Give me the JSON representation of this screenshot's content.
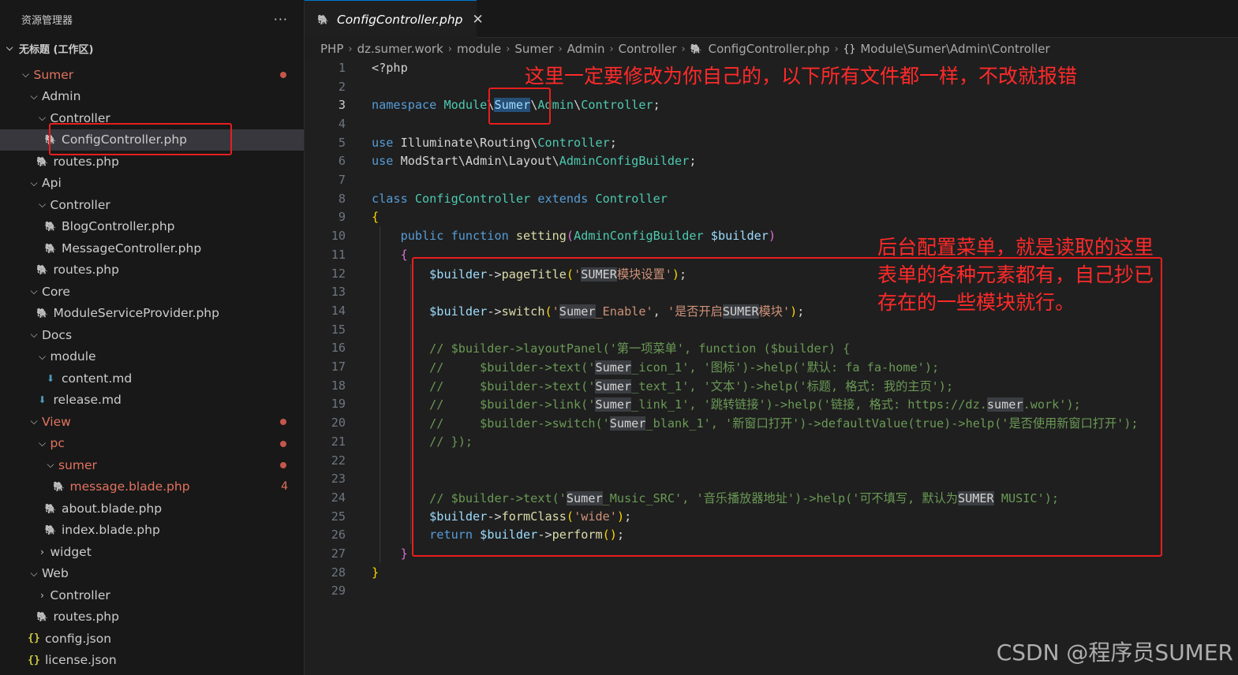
{
  "explorer": {
    "title": "资源管理器",
    "more": "···",
    "workspace": "无标题 (工作区)",
    "items": [
      {
        "label": "Sumer",
        "depth": 1,
        "type": "folder",
        "open": true,
        "modified": true,
        "dot": true
      },
      {
        "label": "Admin",
        "depth": 2,
        "type": "folder",
        "open": true
      },
      {
        "label": "Controller",
        "depth": 3,
        "type": "folder",
        "open": true
      },
      {
        "label": "ConfigController.php",
        "depth": 4,
        "type": "php",
        "selected": true
      },
      {
        "label": "routes.php",
        "depth": 3,
        "type": "php"
      },
      {
        "label": "Api",
        "depth": 2,
        "type": "folder",
        "open": true
      },
      {
        "label": "Controller",
        "depth": 3,
        "type": "folder",
        "open": true
      },
      {
        "label": "BlogController.php",
        "depth": 4,
        "type": "php"
      },
      {
        "label": "MessageController.php",
        "depth": 4,
        "type": "php"
      },
      {
        "label": "routes.php",
        "depth": 3,
        "type": "php"
      },
      {
        "label": "Core",
        "depth": 2,
        "type": "folder",
        "open": true
      },
      {
        "label": "ModuleServiceProvider.php",
        "depth": 3,
        "type": "php"
      },
      {
        "label": "Docs",
        "depth": 2,
        "type": "folder",
        "open": true
      },
      {
        "label": "module",
        "depth": 3,
        "type": "folder",
        "open": true
      },
      {
        "label": "content.md",
        "depth": 4,
        "type": "md"
      },
      {
        "label": "release.md",
        "depth": 3,
        "type": "md"
      },
      {
        "label": "View",
        "depth": 2,
        "type": "folder",
        "open": true,
        "modified": true,
        "dot": true
      },
      {
        "label": "pc",
        "depth": 3,
        "type": "folder",
        "open": true,
        "modified": true,
        "dot": true
      },
      {
        "label": "sumer",
        "depth": 4,
        "type": "folder",
        "open": true,
        "modified": true,
        "dot": true
      },
      {
        "label": "message.blade.php",
        "depth": 5,
        "type": "php",
        "modified": true,
        "badge": "4"
      },
      {
        "label": "about.blade.php",
        "depth": 4,
        "type": "php"
      },
      {
        "label": "index.blade.php",
        "depth": 4,
        "type": "php"
      },
      {
        "label": "widget",
        "depth": 3,
        "type": "folder",
        "open": false
      },
      {
        "label": "Web",
        "depth": 2,
        "type": "folder",
        "open": true
      },
      {
        "label": "Controller",
        "depth": 3,
        "type": "folder",
        "open": false
      },
      {
        "label": "routes.php",
        "depth": 3,
        "type": "php"
      },
      {
        "label": "config.json",
        "depth": 2,
        "type": "json"
      },
      {
        "label": "license.json",
        "depth": 2,
        "type": "json"
      }
    ]
  },
  "tab": {
    "label": "ConfigController.php",
    "close": "✕"
  },
  "breadcrumb": {
    "items": [
      "PHP",
      "dz.sumer.work",
      "module",
      "Sumer",
      "Admin",
      "Controller",
      "ConfigController.php"
    ],
    "symbol_icon": "{}",
    "symbol": "Module\\Sumer\\Admin\\Controller"
  },
  "editor": {
    "current_line": 3,
    "lines": [
      [
        [
          "p",
          "<?php"
        ]
      ],
      [],
      [
        [
          "k",
          "namespace "
        ],
        [
          "t",
          "Module"
        ],
        [
          "p",
          "\\"
        ],
        [
          "hl",
          "Sumer"
        ],
        [
          "p",
          "\\"
        ],
        [
          "t",
          "Admin"
        ],
        [
          "p",
          "\\"
        ],
        [
          "t",
          "Controller"
        ],
        [
          "p",
          ";"
        ]
      ],
      [],
      [
        [
          "k",
          "use "
        ],
        [
          "p",
          "Illuminate\\Routing\\"
        ],
        [
          "t",
          "Controller"
        ],
        [
          "p",
          ";"
        ]
      ],
      [
        [
          "k",
          "use "
        ],
        [
          "p",
          "ModStart\\Admin\\Layout\\"
        ],
        [
          "t",
          "AdminConfigBuilder"
        ],
        [
          "p",
          ";"
        ]
      ],
      [],
      [
        [
          "k",
          "class "
        ],
        [
          "t",
          "ConfigController "
        ],
        [
          "k",
          "extends "
        ],
        [
          "t",
          "Controller"
        ]
      ],
      [
        [
          "b1",
          "{"
        ]
      ],
      [
        [
          "p",
          "    "
        ],
        [
          "k",
          "public function "
        ],
        [
          "f",
          "setting"
        ],
        [
          "b2",
          "("
        ],
        [
          "t",
          "AdminConfigBuilder "
        ],
        [
          "v",
          "$builder"
        ],
        [
          "b2",
          ")"
        ]
      ],
      [
        [
          "p",
          "    "
        ],
        [
          "b2",
          "{"
        ]
      ],
      [
        [
          "p",
          "        "
        ],
        [
          "v",
          "$builder"
        ],
        [
          "p",
          "->"
        ],
        [
          "f",
          "pageTitle"
        ],
        [
          "b1",
          "("
        ],
        [
          "s",
          "'"
        ],
        [
          "hs",
          "SUMER"
        ],
        [
          "s",
          "模块设置'"
        ],
        [
          "b1",
          ")"
        ],
        [
          "p",
          ";"
        ]
      ],
      [],
      [
        [
          "p",
          "        "
        ],
        [
          "v",
          "$builder"
        ],
        [
          "p",
          "->"
        ],
        [
          "f",
          "switch"
        ],
        [
          "b1",
          "("
        ],
        [
          "s",
          "'"
        ],
        [
          "hs",
          "Sumer"
        ],
        [
          "s",
          "_Enable'"
        ],
        [
          "p",
          ", "
        ],
        [
          "s",
          "'是否开启"
        ],
        [
          "hs",
          "SUMER"
        ],
        [
          "s",
          "模块'"
        ],
        [
          "b1",
          ")"
        ],
        [
          "p",
          ";"
        ]
      ],
      [],
      [
        [
          "p",
          "        "
        ],
        [
          "c",
          "// $builder->layoutPanel('第一项菜单', function ($builder) {"
        ]
      ],
      [
        [
          "p",
          "        "
        ],
        [
          "c",
          "//     $builder->text('"
        ],
        [
          "hs",
          "Sumer"
        ],
        [
          "c",
          "_icon_1', '图标')->help('默认: fa fa-home');"
        ]
      ],
      [
        [
          "p",
          "        "
        ],
        [
          "c",
          "//     $builder->text('"
        ],
        [
          "hs",
          "Sumer"
        ],
        [
          "c",
          "_text_1', '文本')->help('标题, 格式: 我的主页');"
        ]
      ],
      [
        [
          "p",
          "        "
        ],
        [
          "c",
          "//     $builder->link('"
        ],
        [
          "hs",
          "Sumer"
        ],
        [
          "c",
          "_link_1', '跳转链接')->help('链接, 格式: https://dz."
        ],
        [
          "hs",
          "sumer"
        ],
        [
          "c",
          ".work');"
        ]
      ],
      [
        [
          "p",
          "        "
        ],
        [
          "c",
          "//     $builder->switch('"
        ],
        [
          "hs",
          "Sumer"
        ],
        [
          "c",
          "_blank_1', '新窗口打开')->defaultValue(true)->help('是否使用新窗口打开');"
        ]
      ],
      [
        [
          "p",
          "        "
        ],
        [
          "c",
          "// });"
        ]
      ],
      [],
      [],
      [
        [
          "p",
          "        "
        ],
        [
          "c",
          "// $builder->text('"
        ],
        [
          "hs",
          "Sumer"
        ],
        [
          "c",
          "_Music_SRC', '音乐播放器地址')->help('可不填写, 默认为"
        ],
        [
          "hs",
          "SUMER"
        ],
        [
          "c",
          " MUSIC');"
        ]
      ],
      [
        [
          "p",
          "        "
        ],
        [
          "v",
          "$builder"
        ],
        [
          "p",
          "->"
        ],
        [
          "f",
          "formClass"
        ],
        [
          "b1",
          "("
        ],
        [
          "s",
          "'wide'"
        ],
        [
          "b1",
          ")"
        ],
        [
          "p",
          ";"
        ]
      ],
      [
        [
          "p",
          "        "
        ],
        [
          "k",
          "return "
        ],
        [
          "v",
          "$builder"
        ],
        [
          "p",
          "->"
        ],
        [
          "f",
          "perform"
        ],
        [
          "b1",
          "()"
        ],
        [
          "p",
          ";"
        ]
      ],
      [
        [
          "p",
          "    "
        ],
        [
          "b2",
          "}"
        ]
      ],
      [
        [
          "b1",
          "}"
        ]
      ],
      []
    ]
  },
  "annotations": {
    "note1": "这里一定要修改为你自己的，以下所有文件都一样，不改就报错",
    "note2_lines": [
      "后台配置菜单，就是读取的这里",
      "表单的各种元素都有，自己抄已",
      "存在的一些模块就行。"
    ]
  },
  "watermark": "CSDN @程序员SUMER",
  "colors": {
    "annotation": "#e81e1e",
    "accent": "#0078d4",
    "modified": "#e2735f"
  }
}
